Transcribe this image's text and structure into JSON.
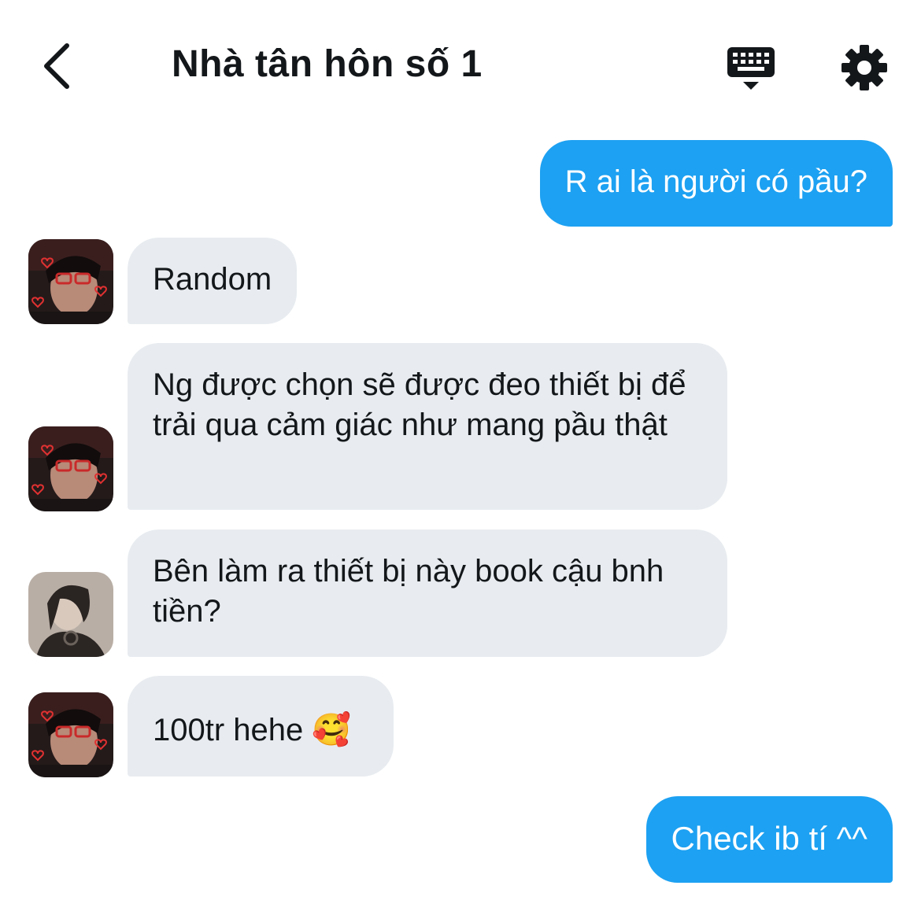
{
  "header": {
    "title": "Nhà tân hôn số 1",
    "back_icon": "chevron-left-icon",
    "keyboard_icon": "keyboard-icon",
    "settings_icon": "gear-icon"
  },
  "colors": {
    "outgoing_bubble": "#1da1f2",
    "incoming_bubble": "#e8ecf0",
    "text": "#14171a"
  },
  "messages": [
    {
      "direction": "out",
      "text": "R ai là người có pầu?"
    },
    {
      "direction": "in",
      "avatar": "avatar-a",
      "text": "Random"
    },
    {
      "direction": "in",
      "avatar": "avatar-a",
      "text": "Ng được chọn sẽ được đeo thiết bị để trải qua cảm giác như mang pầu thật"
    },
    {
      "direction": "in",
      "avatar": "avatar-b",
      "text": "Bên làm ra thiết bị này book cậu bnh tiền?"
    },
    {
      "direction": "in",
      "avatar": "avatar-a",
      "text": "100tr hehe 🥰"
    },
    {
      "direction": "out",
      "text": "Check ib tí ^^"
    }
  ]
}
